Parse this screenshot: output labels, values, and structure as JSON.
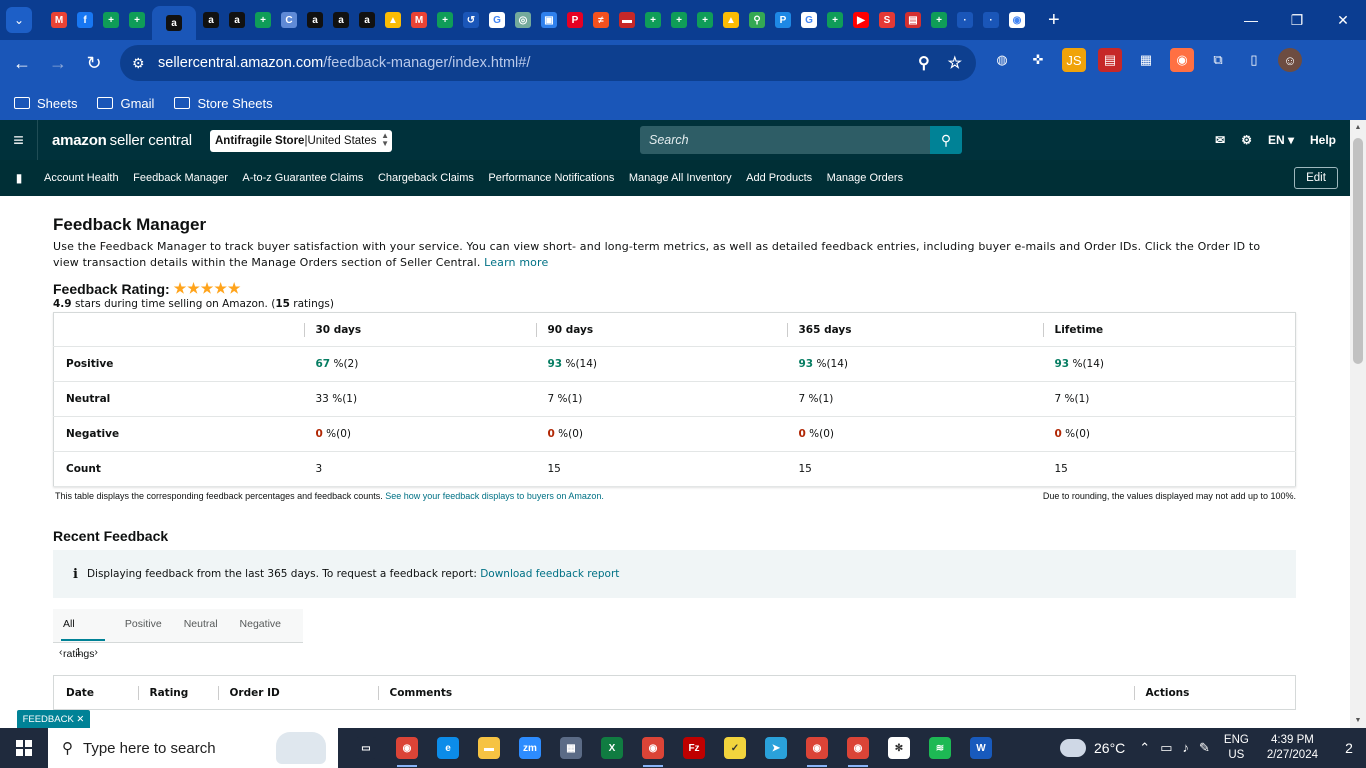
{
  "browser": {
    "tabs": [
      {
        "icon": "tab-list-icon",
        "color": "#1d5fc7",
        "glyph": "⌄"
      },
      {
        "icon": "gmail-icon",
        "color": "#ea4335",
        "glyph": "M"
      },
      {
        "icon": "facebook-icon",
        "color": "#1877f2",
        "glyph": "f"
      },
      {
        "icon": "sheets-icon",
        "color": "#0f9d58",
        "glyph": "+"
      },
      {
        "icon": "sheets-icon",
        "color": "#0f9d58",
        "glyph": "+"
      },
      {
        "icon": "amazon-icon",
        "color": "#111111",
        "glyph": "a"
      },
      {
        "icon": "amazon-icon",
        "color": "#111111",
        "glyph": "a"
      },
      {
        "icon": "amazon-icon",
        "color": "#111111",
        "glyph": "a"
      },
      {
        "icon": "sheets-icon",
        "color": "#0f9d58",
        "glyph": "+"
      },
      {
        "icon": "loading-icon",
        "color": "#5f8ad6",
        "glyph": "C"
      },
      {
        "icon": "amazon-icon",
        "color": "#111111",
        "glyph": "a"
      },
      {
        "icon": "amazon-icon",
        "color": "#111111",
        "glyph": "a"
      },
      {
        "icon": "amazon-icon",
        "color": "#111111",
        "glyph": "a"
      },
      {
        "icon": "drive-icon",
        "color": "#fbbc04",
        "glyph": "▲"
      },
      {
        "icon": "gmail-icon",
        "color": "#ea4335",
        "glyph": "M"
      },
      {
        "icon": "sheets-icon",
        "color": "#0f9d58",
        "glyph": "+"
      },
      {
        "icon": "history-icon",
        "color": "#1a56b8",
        "glyph": "↺"
      },
      {
        "icon": "google-icon",
        "color": "#ffffff",
        "glyph": "G"
      },
      {
        "icon": "chatgpt-icon",
        "color": "#74aa9c",
        "glyph": "◎"
      },
      {
        "icon": "bot-icon",
        "color": "#2f80ed",
        "glyph": "▣"
      },
      {
        "icon": "pinterest-icon",
        "color": "#e60023",
        "glyph": "P"
      },
      {
        "icon": "app-icon",
        "color": "#f4511e",
        "glyph": "≠"
      },
      {
        "icon": "app-icon",
        "color": "#c62828",
        "glyph": "▬"
      },
      {
        "icon": "sheets-icon",
        "color": "#0f9d58",
        "glyph": "+"
      },
      {
        "icon": "sheets-icon",
        "color": "#0f9d58",
        "glyph": "+"
      },
      {
        "icon": "sheets-icon",
        "color": "#0f9d58",
        "glyph": "+"
      },
      {
        "icon": "drive-icon",
        "color": "#fbbc04",
        "glyph": "▲"
      },
      {
        "icon": "maps-icon",
        "color": "#34a853",
        "glyph": "⚲"
      },
      {
        "icon": "app-icon",
        "color": "#1e88e5",
        "glyph": "P"
      },
      {
        "icon": "google-icon",
        "color": "#ffffff",
        "glyph": "G"
      },
      {
        "icon": "sheets-icon",
        "color": "#0f9d58",
        "glyph": "+"
      },
      {
        "icon": "youtube-icon",
        "color": "#ff0000",
        "glyph": "▶"
      },
      {
        "icon": "app-icon",
        "color": "#e53935",
        "glyph": "S"
      },
      {
        "icon": "app-icon",
        "color": "#d32f2f",
        "glyph": "▤"
      },
      {
        "icon": "sheets-icon",
        "color": "#0f9d58",
        "glyph": "+"
      },
      {
        "icon": "app-icon",
        "color": "#1a56b8",
        "glyph": "·"
      },
      {
        "icon": "app-icon",
        "color": "#1a56b8",
        "glyph": "·"
      },
      {
        "icon": "chrome-icon",
        "color": "#ffffff",
        "glyph": "◉"
      }
    ],
    "active_tab_index": 5,
    "url_host": "sellercentral.amazon.com",
    "url_path": "/feedback-manager/index.html#/",
    "bookmarks": [
      "Sheets",
      "Gmail",
      "Store Sheets"
    ],
    "extensions": [
      "globe-icon",
      "puzzle-blue-icon",
      "js-icon",
      "ext-icon",
      "qr-icon",
      "color-icon",
      "extensions-icon",
      "sidepanel-icon",
      "profile-avatar"
    ]
  },
  "seller": {
    "logo_amazon": "amazon",
    "logo_suffix": "seller central",
    "store_name": "Antifragile Store",
    "store_sep": " | ",
    "store_country": "United States",
    "search_placeholder": "Search",
    "language": "EN",
    "help": "Help",
    "nav_links": [
      "Account Health",
      "Feedback Manager",
      "A-to-z Guarantee Claims",
      "Chargeback Claims",
      "Performance Notifications",
      "Manage All Inventory",
      "Add Products",
      "Manage Orders"
    ],
    "edit": "Edit"
  },
  "page": {
    "title": "Feedback Manager",
    "intro": "Use the Feedback Manager to track buyer satisfaction with your service. You can view short- and long-term metrics, as well as detailed feedback entries, including buyer e-mails and Order IDs. Click the Order ID to view transaction details within the Manage Orders section of Seller Central.",
    "learn_more": "Learn more",
    "rating_label": "Feedback Rating:",
    "rating_stars": 5,
    "rating_value": "4.9",
    "rating_text": " stars during time selling on Amazon. (",
    "rating_count": "15",
    "rating_suffix": " ratings)",
    "table_headers": [
      "",
      "30 days",
      "90 days",
      "365 days",
      "Lifetime"
    ],
    "rows": [
      {
        "label": "Positive",
        "cells": [
          {
            "pct": "67",
            "cnt": " %(2)"
          },
          {
            "pct": "93",
            "cnt": " %(14)"
          },
          {
            "pct": "93",
            "cnt": " %(14)"
          },
          {
            "pct": "93",
            "cnt": " %(14)"
          }
        ],
        "tone": "g"
      },
      {
        "label": "Neutral",
        "cells": [
          {
            "pct": "33",
            "cnt": " %(1)"
          },
          {
            "pct": "7",
            "cnt": " %(1)"
          },
          {
            "pct": "7",
            "cnt": " %(1)"
          },
          {
            "pct": "7",
            "cnt": " %(1)"
          }
        ],
        "tone": ""
      },
      {
        "label": "Negative",
        "cells": [
          {
            "pct": "0",
            "cnt": " %(0)"
          },
          {
            "pct": "0",
            "cnt": " %(0)"
          },
          {
            "pct": "0",
            "cnt": " %(0)"
          },
          {
            "pct": "0",
            "cnt": " %(0)"
          }
        ],
        "tone": "r"
      },
      {
        "label": "Count",
        "cells": [
          {
            "pct": "",
            "cnt": "3"
          },
          {
            "pct": "",
            "cnt": "15"
          },
          {
            "pct": "",
            "cnt": "15"
          },
          {
            "pct": "",
            "cnt": "15"
          }
        ],
        "tone": ""
      }
    ],
    "note_left": "This table displays the corresponding feedback percentages and feedback counts.",
    "note_left_link": "See how your feedback displays to buyers on Amazon.",
    "note_right": "Due to rounding, the values displayed may not add up to 100%.",
    "recent_title": "Recent Feedback",
    "info_text": "Displaying feedback from the last 365 days. To request a feedback report:",
    "info_link": "Download feedback report",
    "filter_tabs": [
      "All ratings",
      "Positive",
      "Neutral",
      "Negative"
    ],
    "page_number": "1",
    "recent_headers": [
      "Date",
      "Rating",
      "Order ID",
      "Comments",
      "Actions"
    ],
    "feedback_tab": "FEEDBACK"
  },
  "taskbar": {
    "search_placeholder": "Type here to search",
    "apps": [
      {
        "icon": "task-view-icon",
        "color": "#1f2a3d",
        "glyph": "▭",
        "run": false
      },
      {
        "icon": "chrome-icon",
        "color": "#db4437",
        "glyph": "◉",
        "run": true
      },
      {
        "icon": "edge-icon",
        "color": "#0c8ce9",
        "glyph": "e",
        "run": false
      },
      {
        "icon": "file-explorer-icon",
        "color": "#f6c343",
        "glyph": "▬",
        "run": false
      },
      {
        "icon": "zoom-icon",
        "color": "#2d8cff",
        "glyph": "zm",
        "run": false
      },
      {
        "icon": "calculator-icon",
        "color": "#5b6b86",
        "glyph": "▦",
        "run": false
      },
      {
        "icon": "excel-icon",
        "color": "#107c41",
        "glyph": "X",
        "run": false
      },
      {
        "icon": "chrome-icon",
        "color": "#db4437",
        "glyph": "◉",
        "run": true
      },
      {
        "icon": "filezilla-icon",
        "color": "#bf0000",
        "glyph": "Fz",
        "run": false
      },
      {
        "icon": "notes-icon",
        "color": "#f2d43d",
        "glyph": "✓",
        "run": false
      },
      {
        "icon": "telegram-icon",
        "color": "#2aa1da",
        "glyph": "➤",
        "run": false
      },
      {
        "icon": "chrome-icon",
        "color": "#db4437",
        "glyph": "◉",
        "run": true
      },
      {
        "icon": "chrome-icon",
        "color": "#db4437",
        "glyph": "◉",
        "run": true
      },
      {
        "icon": "slack-icon",
        "color": "#ffffff",
        "glyph": "✻",
        "run": false
      },
      {
        "icon": "spotify-icon",
        "color": "#1db954",
        "glyph": "≋",
        "run": false
      },
      {
        "icon": "word-icon",
        "color": "#185abd",
        "glyph": "W",
        "run": false
      }
    ],
    "temperature": "26°C",
    "lang_top": "ENG",
    "lang_bottom": "US",
    "time": "4:39 PM",
    "date": "2/27/2024",
    "notifications": "2"
  }
}
